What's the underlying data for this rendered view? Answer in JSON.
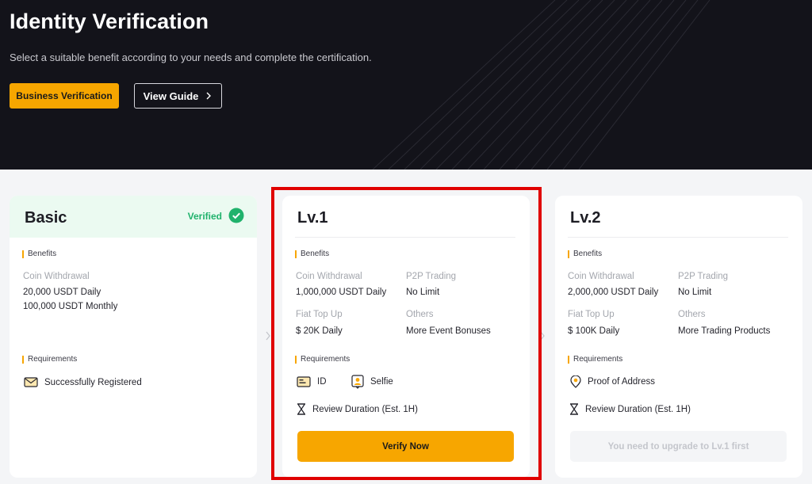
{
  "hero": {
    "title": "Identity Verification",
    "subtitle": "Select a suitable benefit according to your needs and complete the certification.",
    "business_button": "Business Verification",
    "guide_button": "View Guide"
  },
  "colors": {
    "accent": "#f7a600",
    "verified": "#20b26c",
    "highlight": "#e00000",
    "hero_bg": "#13131a"
  },
  "basic": {
    "title": "Basic",
    "status": "Verified",
    "benefits_label": "Benefits",
    "coin_withdrawal_label": "Coin Withdrawal",
    "daily": "20,000 USDT Daily",
    "monthly": "100,000 USDT Monthly",
    "requirements_label": "Requirements",
    "requirement": "Successfully Registered"
  },
  "lv1": {
    "title": "Lv.1",
    "benefits_label": "Benefits",
    "coin_withdrawal_label": "Coin Withdrawal",
    "coin_withdrawal_value": "1,000,000 USDT Daily",
    "p2p_label": "P2P Trading",
    "p2p_value": "No Limit",
    "fiat_label": "Fiat Top Up",
    "fiat_value": "$ 20K Daily",
    "others_label": "Others",
    "others_value": "More Event Bonuses",
    "requirements_label": "Requirements",
    "req_id": "ID",
    "req_selfie": "Selfie",
    "review": "Review Duration (Est. 1H)",
    "verify_button": "Verify Now"
  },
  "lv2": {
    "title": "Lv.2",
    "benefits_label": "Benefits",
    "coin_withdrawal_label": "Coin Withdrawal",
    "coin_withdrawal_value": "2,000,000 USDT Daily",
    "p2p_label": "P2P Trading",
    "p2p_value": "No Limit",
    "fiat_label": "Fiat Top Up",
    "fiat_value": "$ 100K Daily",
    "others_label": "Others",
    "others_value": "More Trading Products",
    "requirements_label": "Requirements",
    "req_address": "Proof of Address",
    "review": "Review Duration (Est. 1H)",
    "disabled_button": "You need to upgrade to Lv.1 first"
  },
  "icons": {
    "check": "check-circle-icon",
    "chevron": "chevron-right-icon",
    "envelope": "envelope-icon",
    "id_card": "id-card-icon",
    "selfie": "selfie-icon",
    "hourglass": "hourglass-icon",
    "location": "location-pin-icon"
  }
}
